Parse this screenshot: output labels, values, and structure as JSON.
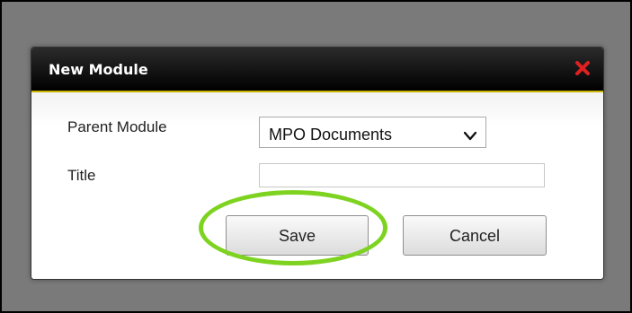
{
  "dialog": {
    "title": "New Module",
    "close_icon": "close-icon",
    "header_accent_color": "#c8b400"
  },
  "form": {
    "parent_module_label": "Parent Module",
    "parent_module_value": "MPO Documents",
    "title_label": "Title",
    "title_value": "",
    "title_placeholder": ""
  },
  "buttons": {
    "save_label": "Save",
    "cancel_label": "Cancel"
  },
  "annotation": {
    "highlight_color": "#7ed321",
    "highlight_target": "save-button"
  }
}
